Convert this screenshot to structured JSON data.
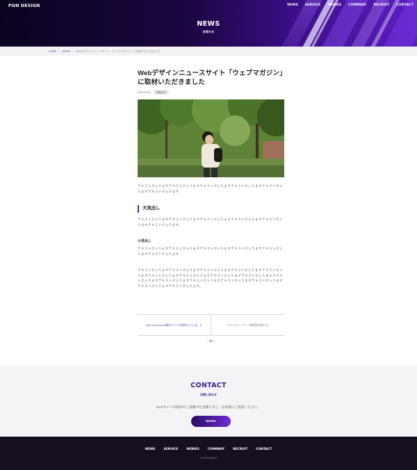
{
  "header": {
    "logo": "PON DESIGN",
    "nav": [
      "NEWS",
      "SERVICE",
      "WORKS",
      "COMPANY",
      "RECRUIT",
      "CONTACT"
    ]
  },
  "hero": {
    "title": "NEWS",
    "subtitle": "お知らせ"
  },
  "breadcrumb": {
    "home": "HOME",
    "sep": ">",
    "news": "NEWS",
    "current": "Webデザインニュースサイト「ウェブマガジン」に取材いただきました"
  },
  "article": {
    "title": "Webデザインニュースサイト「ウェブマガジン」に取材いただきました",
    "date": "2000.00.00",
    "category": "お知らせ",
    "p1": "テキストが入りますテキストが入りますテキストが入りますテキストが入りますテキストが入りますテキストが入ります",
    "h2": "大見出し",
    "p2": "テキストが入りますテキストが入りますテキストが入りますテキストが入りますテキストが入りますテキストが入ります",
    "h3": "小見出し",
    "p3": "テキストが入りますテキストが入りますテキストが入りますテキストが入りますテキストが入りますテキストが入ります",
    "p4": "テキストが入りますテキストが入りますテキストが入りますテキストが入りますテキストが入りますテキストが入りますテキストが入りますテキストが入りますテキストが入りますテキストが入りますテキストが入りますテキストが入りますテキストが入りますテキストが入りますテキストが入りますテキストが入ります。"
  },
  "pager": {
    "prev": "Web Conference様のサイトを制作いたしました",
    "next": "プライバシーマーク取得のお知らせ",
    "back": "一覧へ"
  },
  "contact": {
    "title": "CONTACT",
    "subtitle": "お問い合わせ",
    "text": "Webサイトの制作のご依頼やお見積りなど、お気軽にご相談ください。",
    "button": "MORE"
  },
  "footer": {
    "nav": [
      "NEWS",
      "SERVICE",
      "WORKS",
      "COMPANY",
      "RECRUIT",
      "CONTACT"
    ],
    "copyright": "© PON DESIGN"
  },
  "colors": {
    "accent": "#3a1a8e",
    "link": "#5b4bb0",
    "footer_bg": "#150f1f"
  }
}
